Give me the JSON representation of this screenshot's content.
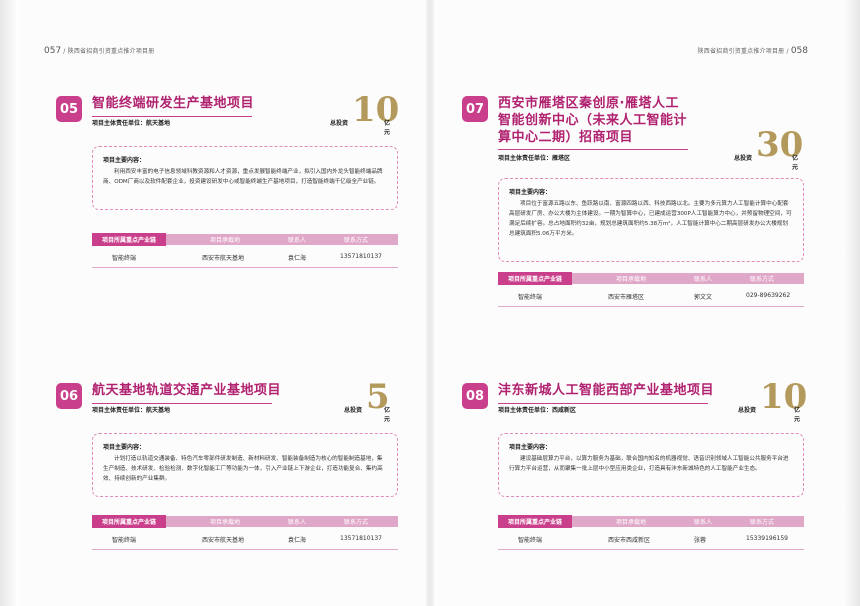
{
  "header": {
    "left_page_no": "057",
    "left_title": "陕西省招商引资重点推介项目册",
    "right_title": "陕西省招商引资重点推介项目册",
    "right_page_no": "058"
  },
  "labels": {
    "unit": "项目主体责任单位：",
    "investment": "总投资",
    "invest_unit": "亿元",
    "content": "项目主要内容：",
    "col_chain": "项目所属重点产业链",
    "col_carrier": "项目承载地",
    "col_contact": "联系人",
    "col_phone": "联系方式"
  },
  "projects": [
    {
      "no": "05",
      "title": "智能终端研发生产基地项目",
      "unit": "航天基地",
      "investment": "10",
      "content": "利用西安丰富的电子信息领域科教资源和人才资源，重点发展智能终端产业，拟引入国内外龙头智能终端品牌商、ODM厂商以及软件配套企业，投资建设研发中心或智能终端生产基地项目，打造智能终端千亿级全产业链。",
      "chain": "智能终端",
      "carrier": "西安市航天基地",
      "contact": "袁仁海",
      "phone": "13571810137"
    },
    {
      "no": "06",
      "title": "航天基地轨道交通产业基地项目",
      "unit": "航天基地",
      "investment": "5",
      "content": "计划打造以轨道交通装备、特色汽车零部件研发制造、新材料研发、智能装备制造为核心的智能制造基地，集生产制造、技术研发、检验检测、数字化智能工厂等功能为一体，引入产业链上下游企业，打造功能复合、集约高效、持续创新的产业集群。",
      "chain": "智能终端",
      "carrier": "西安市航天基地",
      "contact": "袁仁海",
      "phone": "13571810137"
    },
    {
      "no": "07",
      "title_lines": [
        "西安市雁塔区秦创原·雁塔人工",
        "智能创新中心（未来人工智能计",
        "算中心二期）招商项目"
      ],
      "unit": "雁塔区",
      "investment": "30",
      "content": "项目位于富源五路以东、鱼跃路以南、富源四路以西、科技西路以北。主要为多元算力人工智能计算中心配套高层研发厂房、办公大楼为主体建设。一期为智算中心，已建成运营300P人工智能算力中心，并预留物理空间，可满足后续扩容。总占地面积约32亩，规划总建筑面积约5.38万m²，人工智能计算中心二期高层研发办公大楼规划总建筑面积5.06万平方米。",
      "chain": "智能终端",
      "carrier": "西安市雁塔区",
      "contact": "郭文文",
      "phone": "029-89639262"
    },
    {
      "no": "08",
      "title": "沣东新城人工智能西部产业基地项目",
      "unit": "西咸新区",
      "investment": "10",
      "content": "建设基础层算力平台，以算力服务为基础，联合国内知名的机器视觉、语音识别领域人工智能公共服务平台进行算力平台运营，从而聚集一批上层中小型应用类企业，打造具有沣东新城特色的人工智能产业生态。",
      "chain": "智能终端",
      "carrier": "西安市西咸新区",
      "contact": "张蓉",
      "phone": "15339196159"
    }
  ]
}
